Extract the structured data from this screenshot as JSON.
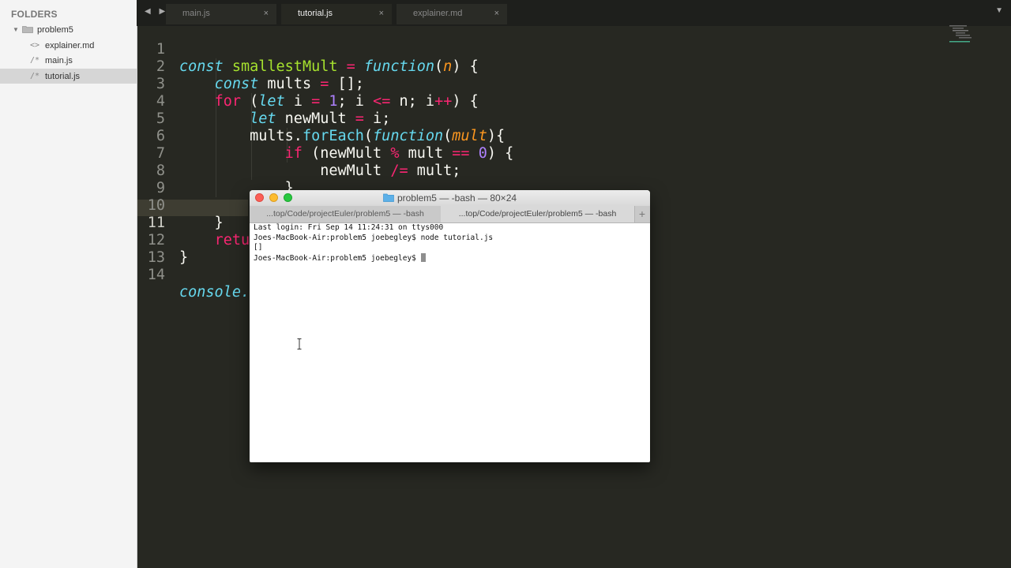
{
  "sidebar": {
    "header": "FOLDERS",
    "folder": "problem5",
    "files": [
      {
        "icon": "<>",
        "name": "explainer.md"
      },
      {
        "icon": "/*",
        "name": "main.js"
      },
      {
        "icon": "/*",
        "name": "tutorial.js"
      }
    ]
  },
  "tabs": [
    {
      "label": "main.js",
      "close": "×"
    },
    {
      "label": "tutorial.js",
      "close": "×"
    },
    {
      "label": "explainer.md",
      "close": "×"
    }
  ],
  "tabbar": {
    "nav": "◀ ▶",
    "dropdown": "▼"
  },
  "editor": {
    "line_numbers": [
      "1",
      "2",
      "3",
      "4",
      "5",
      "6",
      "7",
      "8",
      "9",
      "10",
      "11",
      "12",
      "13",
      "14"
    ],
    "tokens": {
      "l1": [
        "const",
        " ",
        "smallestMult",
        " ",
        "=",
        " ",
        "function",
        "(",
        "n",
        ") {"
      ],
      "l2": [
        "    ",
        "const",
        " mults ",
        "=",
        " [];"
      ],
      "l3": [
        "    ",
        "for",
        " (",
        "let",
        " i ",
        "=",
        " ",
        "1",
        "; i ",
        "<=",
        " n; i",
        "++",
        ") {"
      ],
      "l4": [
        "        ",
        "let",
        " newMult ",
        "=",
        " i;"
      ],
      "l5": [
        "        mults.",
        "forEach",
        "(",
        "function",
        "(",
        "mult",
        "){"
      ],
      "l6": [
        "            ",
        "if",
        " (newMult ",
        "%",
        " mult ",
        "==",
        " ",
        "0",
        ") {"
      ],
      "l7": [
        "                newMult ",
        "/=",
        " mult;"
      ],
      "l8": [
        "            }"
      ],
      "l9": [
        "        })"
      ],
      "l10": [
        "    }"
      ],
      "l11": [
        "    ",
        "retu"
      ],
      "l12": [
        "}"
      ],
      "l13": [
        ""
      ],
      "l14": [
        "console."
      ]
    }
  },
  "terminal": {
    "title": "problem5 — -bash — 80×24",
    "tabs": [
      "...top/Code/projectEuler/problem5 — -bash",
      "...top/Code/projectEuler/problem5 — -bash"
    ],
    "plus": "+",
    "lines": [
      "Last login: Fri Sep 14 11:24:31 on ttys000",
      "Joes-MacBook-Air:problem5 joebegley$ node tutorial.js",
      "[]",
      "Joes-MacBook-Air:problem5 joebegley$ "
    ]
  }
}
